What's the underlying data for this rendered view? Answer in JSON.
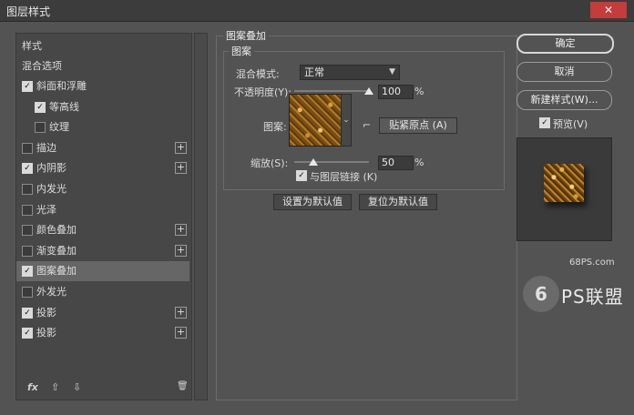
{
  "window": {
    "title": "图层样式",
    "close_glyph": "✕"
  },
  "left_panel": {
    "header": "样式",
    "blend_options": "混合选项",
    "items": [
      {
        "label": "斜面和浮雕",
        "checked": true,
        "has_plus": false,
        "indent": false
      },
      {
        "label": "等高线",
        "checked": true,
        "has_plus": false,
        "indent": true
      },
      {
        "label": "纹理",
        "checked": false,
        "has_plus": false,
        "indent": true
      },
      {
        "label": "描边",
        "checked": false,
        "has_plus": true,
        "indent": false
      },
      {
        "label": "内阴影",
        "checked": true,
        "has_plus": true,
        "indent": false
      },
      {
        "label": "内发光",
        "checked": false,
        "has_plus": false,
        "indent": false
      },
      {
        "label": "光泽",
        "checked": false,
        "has_plus": false,
        "indent": false
      },
      {
        "label": "颜色叠加",
        "checked": false,
        "has_plus": true,
        "indent": false
      },
      {
        "label": "渐变叠加",
        "checked": false,
        "has_plus": true,
        "indent": false
      },
      {
        "label": "图案叠加",
        "checked": true,
        "has_plus": false,
        "indent": false,
        "selected": true
      },
      {
        "label": "外发光",
        "checked": false,
        "has_plus": false,
        "indent": false
      },
      {
        "label": "投影",
        "checked": true,
        "has_plus": true,
        "indent": false
      },
      {
        "label": "投影",
        "checked": true,
        "has_plus": true,
        "indent": false
      }
    ],
    "bottom": {
      "fx": "fx",
      "up": "⇧",
      "down": "⇩",
      "trash": "🗑"
    }
  },
  "pattern_overlay": {
    "group_title": "图案叠加",
    "subgroup_title": "图案",
    "blend_mode_label": "混合模式:",
    "blend_mode_value": "正常",
    "opacity_label": "不透明度(Y):",
    "opacity_value": "100",
    "opacity_level": 1.0,
    "percent": "%",
    "pattern_label": "图案:",
    "snap_origin_button": "贴紧原点 (A)",
    "scale_label": "缩放(S):",
    "scale_value": "50",
    "scale_level": 0.25,
    "link_label": "与图层链接 (K)",
    "link_checked": true,
    "set_default_button": "设置为默认值",
    "reset_default_button": "复位为默认值"
  },
  "right": {
    "ok_button": "确定",
    "cancel_button": "取消",
    "new_style_button": "新建样式(W)...",
    "preview_label": "预览(V)",
    "preview_checked": true
  },
  "watermark": {
    "site": "68PS.com",
    "brand": "PS联盟",
    "logo_glyph": "6"
  },
  "colors": {
    "dialog_bg": "#535353",
    "close_red": "#c43c3c",
    "gold": "#b07a23"
  }
}
